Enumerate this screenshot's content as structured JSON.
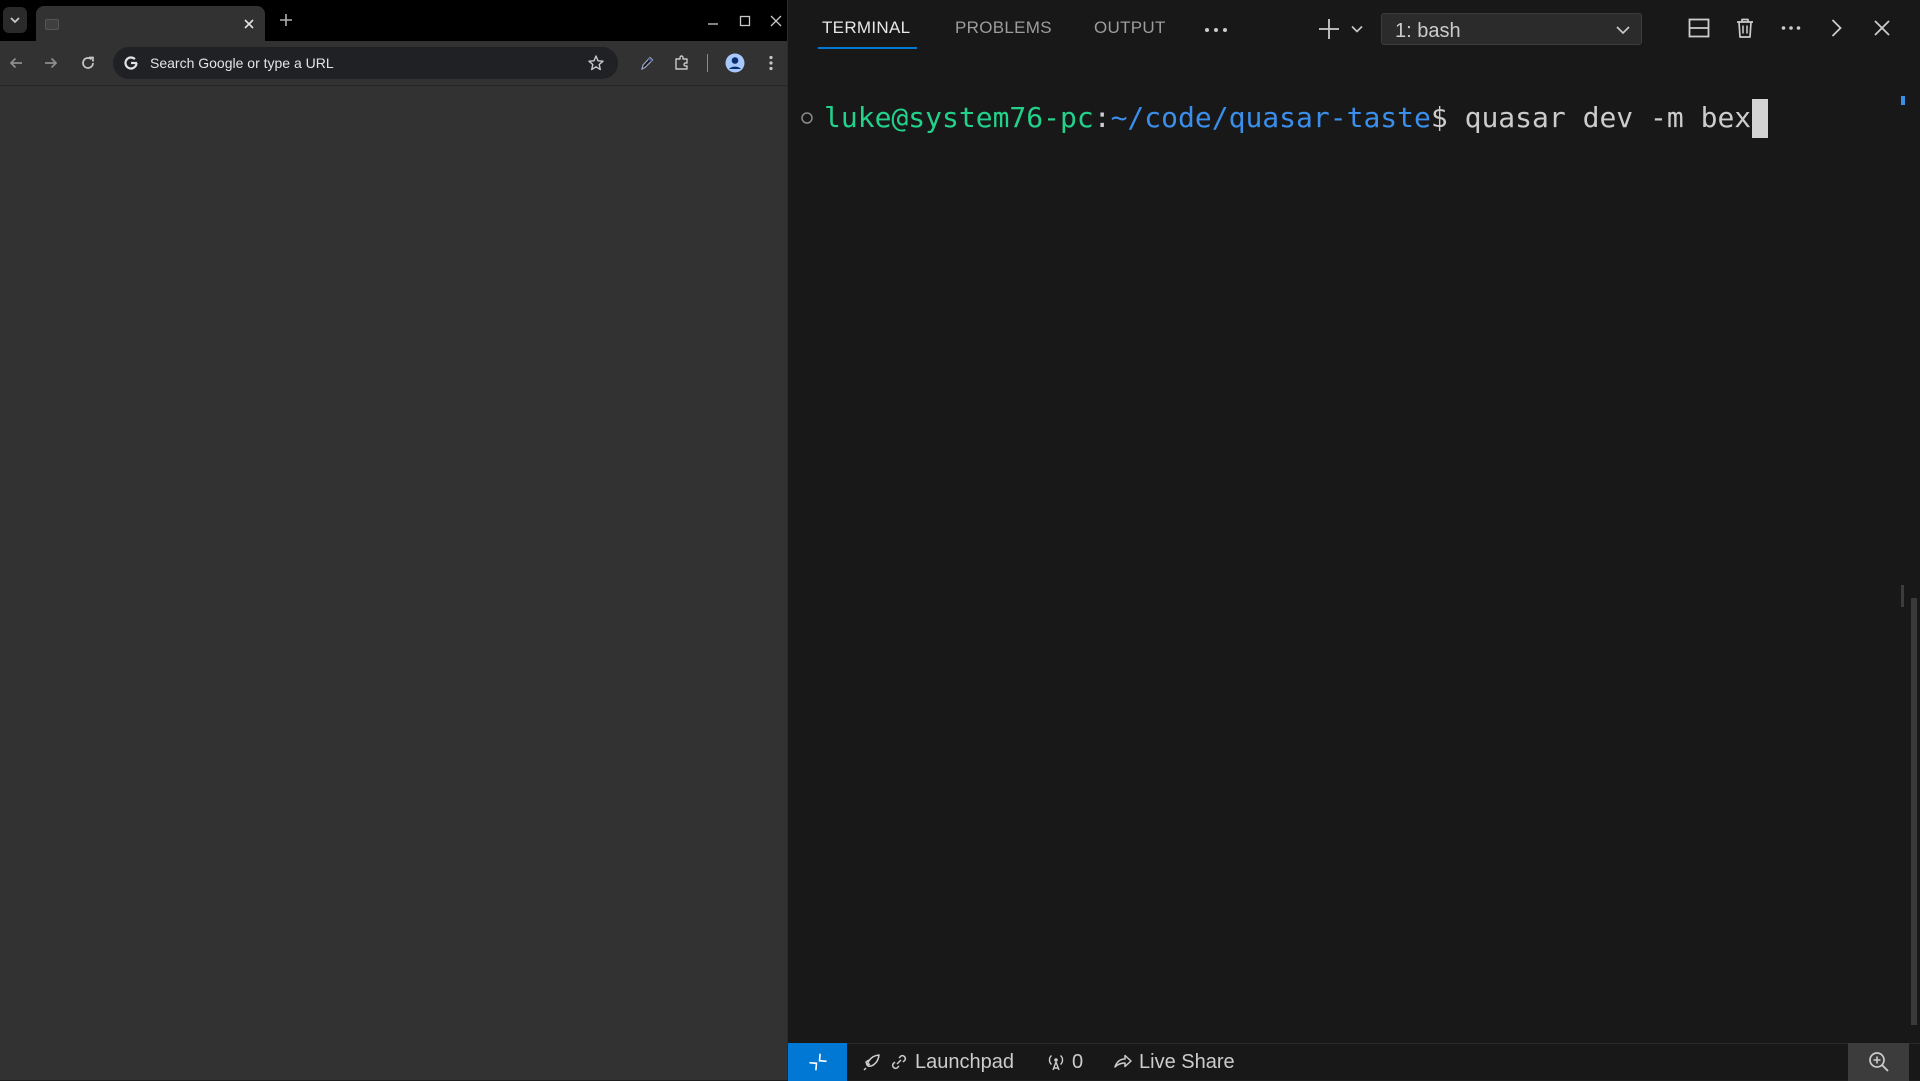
{
  "browser": {
    "tab": {
      "title": ""
    },
    "omnibox": {
      "placeholder": "Search Google or type a URL",
      "value": ""
    }
  },
  "panel": {
    "tabs": [
      {
        "label": "TERMINAL",
        "active": true
      },
      {
        "label": "PROBLEMS",
        "active": false
      },
      {
        "label": "OUTPUT",
        "active": false
      }
    ],
    "more_tabs_label": "···",
    "terminal_select": {
      "value": "1: bash"
    }
  },
  "terminal": {
    "prompt_user_host": "luke@system76-pc",
    "prompt_separator": ":",
    "prompt_path": "~/code/quasar-taste",
    "prompt_symbol": "$",
    "command": " quasar dev -m bex"
  },
  "status_bar": {
    "launchpad_label": "Launchpad",
    "ports_count": "0",
    "liveshare_label": "Live Share"
  },
  "colors": {
    "accent": "#0078d4",
    "prompt_user": "#23d18b",
    "prompt_path": "#3b8eea",
    "terminal_bg": "#181818",
    "browser_bg": "#323232"
  },
  "icons": {
    "browser": [
      "tab-list-icon",
      "favicon-icon",
      "close-icon",
      "plus-icon",
      "minimize-icon",
      "maximize-icon",
      "close-icon",
      "back-arrow-icon",
      "forward-arrow-icon",
      "reload-icon",
      "google-g-icon",
      "star-icon",
      "pen-icon",
      "puzzle-icon",
      "profile-icon",
      "kebab-menu-icon"
    ],
    "panel": [
      "plus-icon",
      "chevron-down-icon",
      "split-icon",
      "trash-icon",
      "ellipsis-icon",
      "chevron-right-icon",
      "close-icon"
    ],
    "status_bar": [
      "remote-icon",
      "rocket-icon",
      "broadcast-icon",
      "live-share-icon",
      "zoom-in-icon"
    ]
  }
}
